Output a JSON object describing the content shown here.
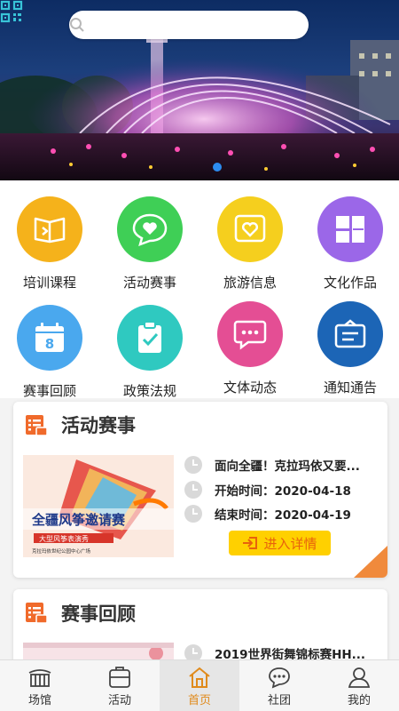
{
  "search": {
    "placeholder": ""
  },
  "banner": {
    "active_slide": 1
  },
  "grid": {
    "items": [
      {
        "label": "培训课程",
        "icon": "book-icon",
        "color": "#f5b21b"
      },
      {
        "label": "活动赛事",
        "icon": "chat-heart-icon",
        "color": "#3fcf56"
      },
      {
        "label": "旅游信息",
        "icon": "heart-frame-icon",
        "color": "#f5cf1e"
      },
      {
        "label": "文化作品",
        "icon": "tiles-icon",
        "color": "#9b67e8"
      },
      {
        "label": "赛事回顾",
        "icon": "calendar-icon",
        "color": "#4aa8ee",
        "badge": "8"
      },
      {
        "label": "政策法规",
        "icon": "clipboard-check-icon",
        "color": "#2fc9c0"
      },
      {
        "label": "文体动态",
        "icon": "speech-bubble-icon",
        "color": "#e44e94"
      },
      {
        "label": "通知通告",
        "icon": "notice-icon",
        "color": "#1c65b6"
      }
    ]
  },
  "activity_card": {
    "title": "活动赛事",
    "rows": [
      {
        "text": "面向全疆！克拉玛依又要..."
      },
      {
        "text": "开始时间：2020-04-18"
      },
      {
        "text": "结束时间：2020-04-19"
      }
    ],
    "button_label": "进入详情",
    "poster": {
      "headline": "全疆风筝邀请赛",
      "subline": "大型风筝表演秀",
      "small_text": "克拉玛依世纪公园中心广场"
    }
  },
  "review_card": {
    "title": "赛事回顾",
    "rows": [
      {
        "text": "2019世界街舞锦标赛HH..."
      }
    ]
  },
  "tabbar": {
    "items": [
      {
        "label": "场馆",
        "icon": "venue-icon",
        "active": false
      },
      {
        "label": "活动",
        "icon": "activity-icon",
        "active": false
      },
      {
        "label": "首页",
        "icon": "home-icon",
        "active": true
      },
      {
        "label": "社团",
        "icon": "community-icon",
        "active": false
      },
      {
        "label": "我的",
        "icon": "profile-icon",
        "active": false
      }
    ]
  }
}
